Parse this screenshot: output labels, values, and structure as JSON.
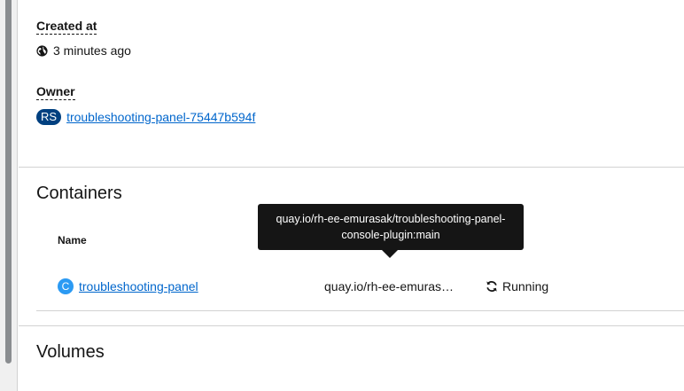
{
  "details": {
    "created_at_label": "Created at",
    "created_at_value": "3 minutes ago",
    "owner_label": "Owner",
    "owner_badge": "RS",
    "owner_link": "troubleshooting-panel-75447b594f"
  },
  "containers": {
    "title": "Containers",
    "column_name": "Name",
    "rows": [
      {
        "badge": "C",
        "name": "troubleshooting-panel",
        "image": "quay.io/rh-ee-emuras…",
        "status": "Running"
      }
    ],
    "tooltip_line1": "quay.io/rh-ee-emurasak/troubleshooting-panel-",
    "tooltip_line2": "console-plugin:main"
  },
  "volumes": {
    "title": "Volumes"
  },
  "colors": {
    "link": "#0066cc",
    "owner_badge_bg": "#004080",
    "container_badge_bg": "#2b9af3",
    "tooltip_bg": "#151515"
  }
}
